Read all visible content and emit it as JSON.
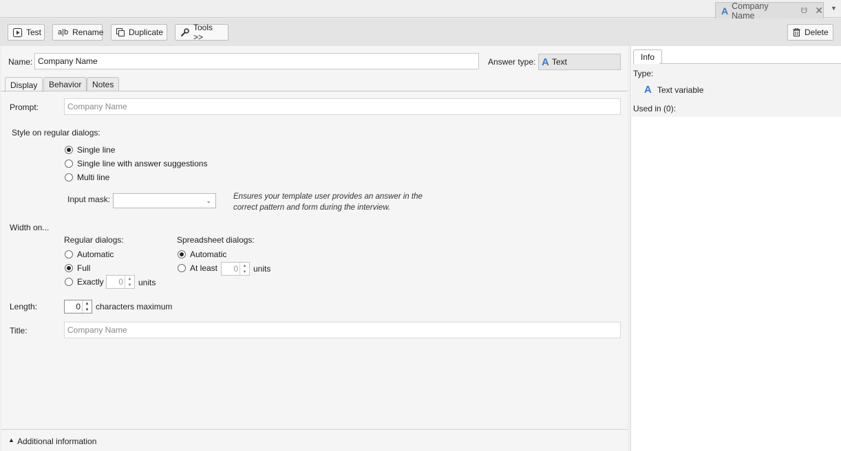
{
  "doc_tab": {
    "title": "Company Name",
    "pin_icon": "pin-icon",
    "close_icon": "close-icon"
  },
  "toolbar": {
    "test_label": "Test",
    "rename_label": "Rename",
    "rename_glyph": "a|b",
    "duplicate_label": "Duplicate",
    "tools_label": "Tools >>",
    "delete_label": "Delete"
  },
  "header": {
    "name_label": "Name:",
    "name_value": "Company Name",
    "answer_type_label": "Answer type:",
    "answer_type_value": "Text"
  },
  "tabs": [
    {
      "label": "Display",
      "active": true
    },
    {
      "label": "Behavior",
      "active": false
    },
    {
      "label": "Notes",
      "active": false
    }
  ],
  "display": {
    "prompt_label": "Prompt:",
    "prompt_placeholder": "Company Name",
    "style_label": "Style on regular dialogs:",
    "style_options": [
      "Single line",
      "Single line with answer suggestions",
      "Multi line"
    ],
    "style_selected": "Single line",
    "input_mask_label": "Input mask:",
    "input_mask_value": "",
    "input_mask_hint": "Ensures your template user provides an answer in the correct pattern and form during the interview.",
    "width_label": "Width on...",
    "regular_label": "Regular dialogs:",
    "regular_options": [
      "Automatic",
      "Full",
      "Exactly"
    ],
    "regular_selected": "Full",
    "regular_exactly_value": "0",
    "regular_units": "units",
    "spreadsheet_label": "Spreadsheet dialogs:",
    "spreadsheet_options": [
      "Automatic",
      "At least"
    ],
    "spreadsheet_selected": "Automatic",
    "spreadsheet_atleast_value": "0",
    "spreadsheet_units": "units",
    "length_label": "Length:",
    "length_value": "0",
    "length_suffix": "characters maximum",
    "title_label": "Title:",
    "title_placeholder": "Company Name"
  },
  "footer": {
    "label": "Additional information"
  },
  "info_panel": {
    "tab_label": "Info",
    "type_label": "Type:",
    "type_value": "Text variable",
    "used_in_label": "Used in (0):"
  },
  "colors": {
    "text_variable_icon": "#3a78c9"
  }
}
